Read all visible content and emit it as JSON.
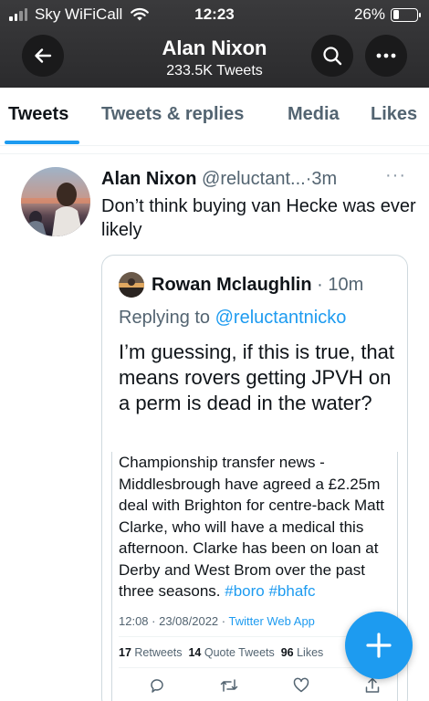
{
  "status_bar": {
    "carrier": "Sky WiFiCall",
    "time": "12:23",
    "battery_text": "26%",
    "battery_level": 0.26
  },
  "header": {
    "name": "Alan Nixon",
    "subtitle": "233.5K Tweets",
    "back_icon": "arrow-left-icon",
    "search_icon": "search-icon",
    "more_icon": "more-horizontal-icon"
  },
  "tabs": [
    {
      "label": "Tweets",
      "active": true
    },
    {
      "label": "Tweets & replies",
      "active": false
    },
    {
      "label": "Media",
      "active": false
    },
    {
      "label": "Likes",
      "active": false
    }
  ],
  "tweet": {
    "name": "Alan Nixon",
    "handle": "@reluctant...",
    "separator": "·",
    "time": "3m",
    "more": "···",
    "text": "Don’t think buying van Hecke was ever likely",
    "quote": {
      "name": "Rowan Mclaughlin",
      "separator": "·",
      "time": "10m",
      "reply_prefix": "Replying to",
      "reply_handle": "@reluctantnicko",
      "text": "I’m guessing, if this is true, that means rovers getting JPVH on a perm is dead in the water?",
      "embed": {
        "text": "Championship transfer news - Middlesbrough have agreed a £2.25m deal with Brighton for centre-back Matt Clarke, who will have a medical this afternoon. Clarke has been on loan at Derby and West Brom over the past three seasons.",
        "hashtag1": "#boro",
        "hashtag2": "#bhafc",
        "timestamp": "12:08 · 23/08/2022 ·",
        "app": "Twitter Web App",
        "retweets_count": "17",
        "retweets_label": "Retweets",
        "quotes_count": "14",
        "quotes_label": "Quote Tweets",
        "likes_count": "96",
        "likes_label": "Likes"
      }
    }
  },
  "fab": {
    "icon": "plus-icon"
  },
  "colors": {
    "accent": "#1d9bf0",
    "header_bg": "#2f2f31",
    "muted": "#536471"
  }
}
